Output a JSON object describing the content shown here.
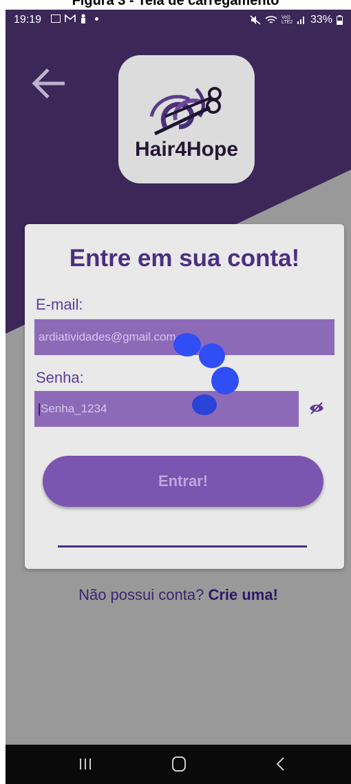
{
  "caption": "Figura 3 - Tela de carregamento",
  "status_bar": {
    "time": "19:19",
    "battery": "33%",
    "icons": [
      "image-icon",
      "gmail-icon",
      "person-icon",
      "dot-icon",
      "mute-icon",
      "wifi-icon",
      "volte-icon",
      "signal-icon",
      "battery-icon"
    ],
    "volte_text": "Vo))\nLTE2"
  },
  "logo": {
    "text": "Hair4Hope"
  },
  "login": {
    "title": "Entre em sua conta!",
    "email_label": "E-mail:",
    "email_value": "ardiatividades@gmail.com",
    "password_label": "Senha:",
    "password_value": "Senha_1234",
    "submit_label": "Entrar!"
  },
  "signup": {
    "prompt": "Não possui conta?",
    "link": "Crie uma!"
  },
  "colors": {
    "brand_purple": "#634293",
    "title_purple": "#4a2f80",
    "spinner_blue": "#2f4ef5",
    "nav_bar": "#0a0a0a"
  },
  "state": {
    "loading": true
  }
}
